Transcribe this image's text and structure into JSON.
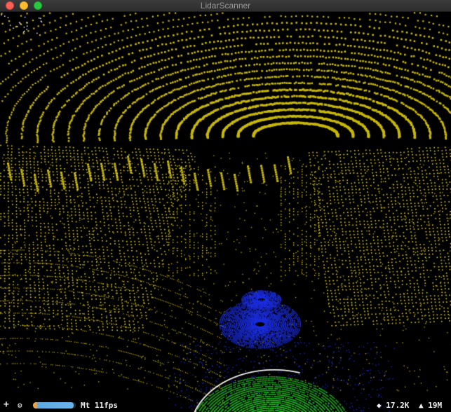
{
  "window": {
    "title": "LidarScanner"
  },
  "hud": {
    "add_label": "+",
    "settings_icon": "gear-icon",
    "progress_fraction": 0.95,
    "fps_text": "Mt 11fps",
    "points_text": "◆ 17.2K",
    "memory_text": "▲ 19M"
  },
  "colors": {
    "ground": "#c8b80a",
    "walls": "#e6d21e",
    "object_blue": "#1c2ee0",
    "object_green": "#22c81e",
    "highlight": "#ffffff"
  }
}
